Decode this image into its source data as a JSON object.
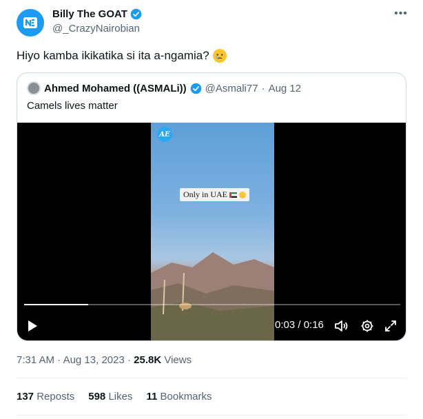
{
  "author": {
    "name": "Billy The GOAT",
    "handle": "@_CrazyNairobian",
    "verified": true,
    "avatar_color": "#1d9bf0"
  },
  "more_icon": "ellipsis-icon",
  "tweet": {
    "text": "Hiyo kamba ikikatika si ita a-ngamia?",
    "emoji": "face-holding-back-tears"
  },
  "quote": {
    "name": "Ahmed Mohamed ((ASMALi))",
    "handle": "@Asmali77",
    "separator": "·",
    "date": "Aug 12",
    "text": "Camels lives matter",
    "video": {
      "watermark": "AE",
      "caption": "Only in UAE",
      "caption_emoji": "flag-uae heart-eyes",
      "time": "0:03 / 0:16",
      "progress": 0.17,
      "controls": [
        "play-icon",
        "volume-icon",
        "settings-icon",
        "fullscreen-icon"
      ]
    }
  },
  "meta": {
    "time": "7:31 AM",
    "separator": " · ",
    "date": "Aug 13, 2023",
    "views_count": "25.8K",
    "views_label": "Views"
  },
  "stats": {
    "reposts_count": "137",
    "reposts_label": "Reposts",
    "likes_count": "598",
    "likes_label": "Likes",
    "bookmarks_count": "11",
    "bookmarks_label": "Bookmarks"
  },
  "colors": {
    "accent": "#1d9bf0",
    "text_primary": "#0f1419",
    "text_secondary": "#536471",
    "border": "#cfd9de"
  }
}
